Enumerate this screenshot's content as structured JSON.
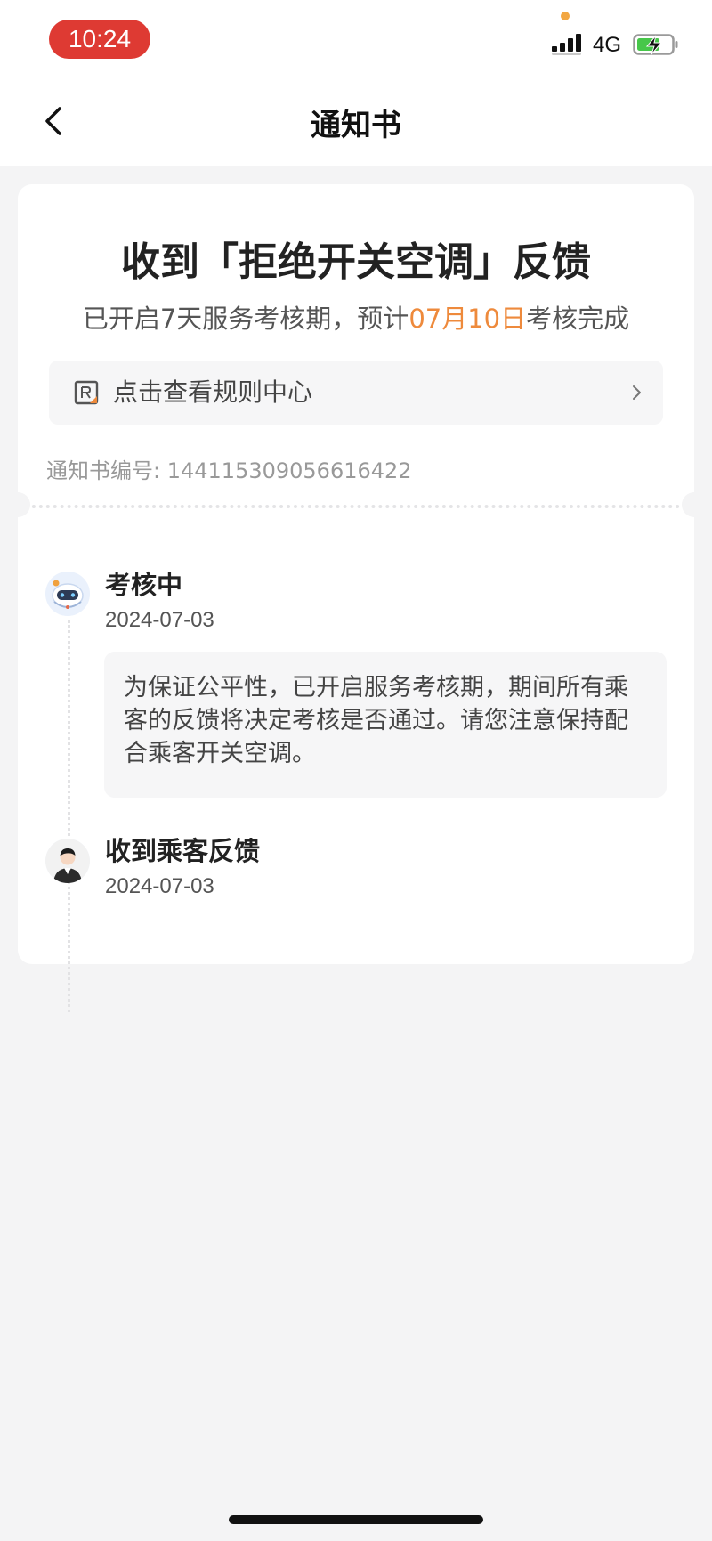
{
  "status_bar": {
    "time": "10:24",
    "network": "4G",
    "icons": [
      "signal-icon",
      "battery-charging-icon"
    ],
    "colors": {
      "time_pill": "#de3a33",
      "battery_charge": "#47c74a"
    }
  },
  "nav": {
    "back_icon": "chevron-left-icon",
    "title": "通知书"
  },
  "card": {
    "headline": "收到「拒绝开关空调」反馈",
    "subline": {
      "prefix": "已开启7天服务考核期，预计",
      "highlight": "07月10日",
      "suffix": "考核完成",
      "highlight_color": "#ee8a3c"
    },
    "rules_link": {
      "icon": "rules-doc-icon",
      "label": "点击查看规则中心",
      "chevron": "chevron-right-icon"
    },
    "notice_number": {
      "label": "通知书编号: ",
      "value": "144115309056616422"
    }
  },
  "timeline": [
    {
      "title": "考核中",
      "date": "2024-07-03",
      "avatar": "robot-avatar-icon",
      "note": "为保证公平性，已开启服务考核期，期间所有乘客的反馈将决定考核是否通过。请您注意保持配合乘客开关空调。"
    },
    {
      "title": "收到乘客反馈",
      "date": "2024-07-03",
      "avatar": "passenger-avatar-icon"
    }
  ]
}
